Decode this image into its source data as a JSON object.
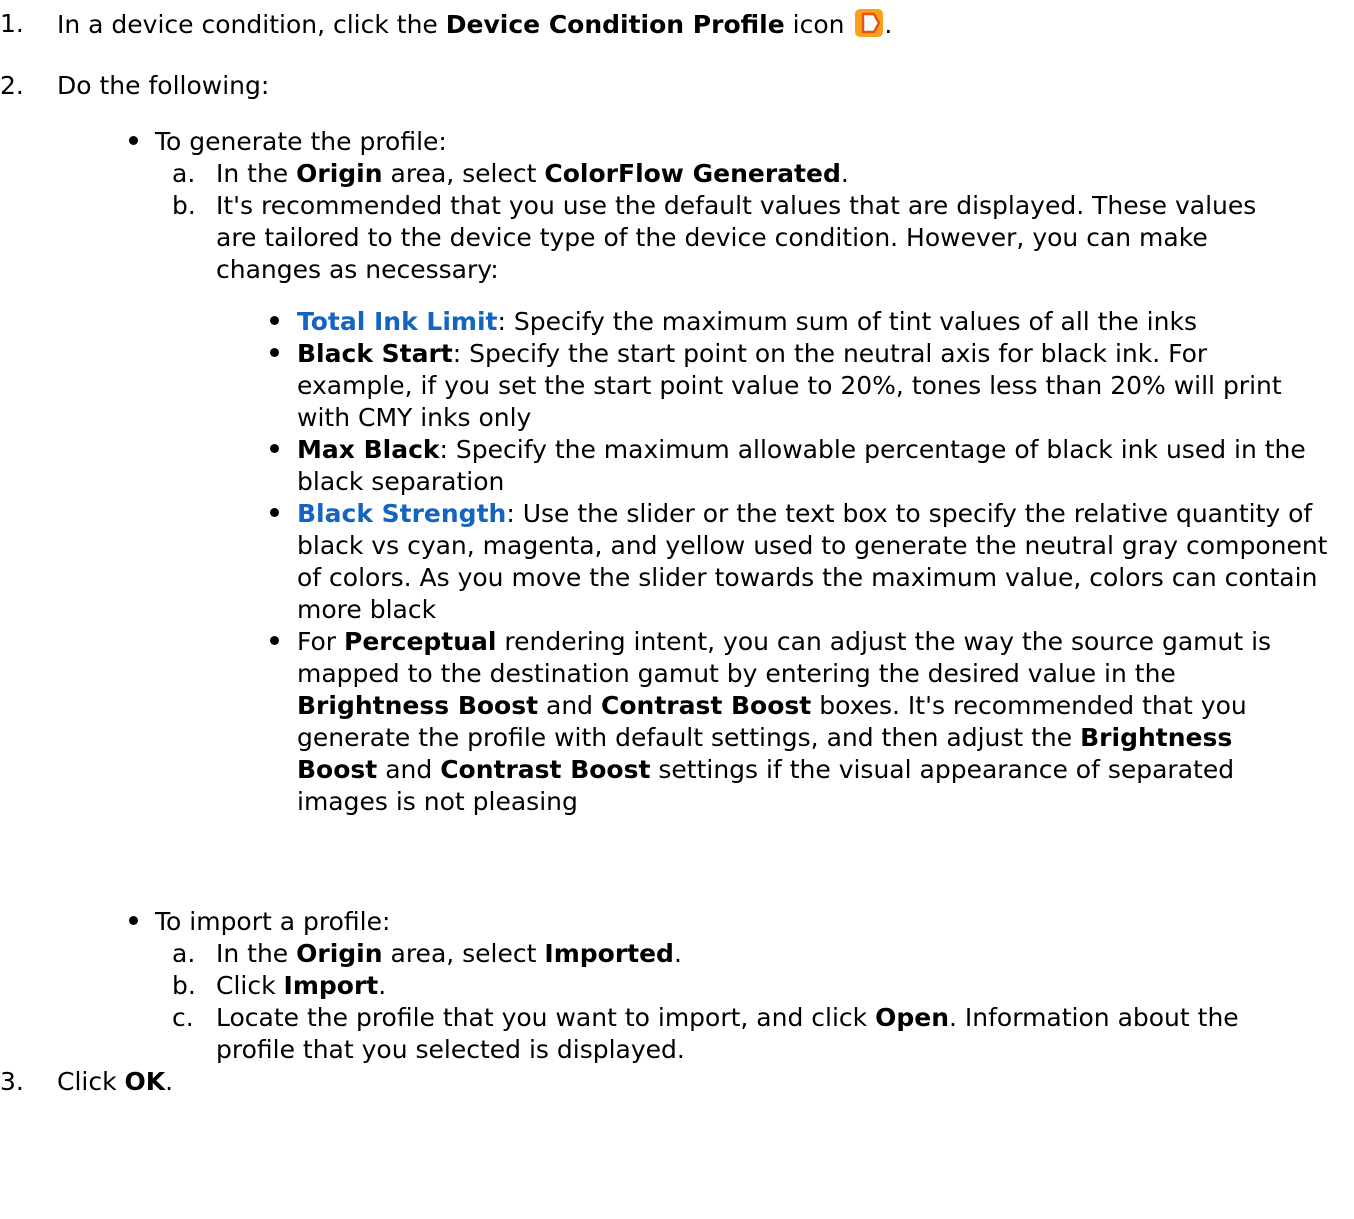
{
  "steps": [
    {
      "num": "1.",
      "parts": [
        {
          "t": "In a device condition, click the "
        },
        {
          "t": "Device Condition Profile",
          "b": true
        },
        {
          "t": " icon "
        },
        {
          "icon": "device-condition-profile-icon"
        },
        {
          "t": "."
        }
      ]
    },
    {
      "num": "2.",
      "parts": [
        {
          "t": "Do the following:"
        }
      ]
    },
    {
      "num": "3.",
      "parts": [
        {
          "t": "Click "
        },
        {
          "t": "OK",
          "b": true
        },
        {
          "t": "."
        }
      ]
    }
  ],
  "generate": {
    "intro": "To generate the profile:",
    "substeps": [
      {
        "letter": "a.",
        "parts": [
          {
            "t": "In the "
          },
          {
            "t": "Origin",
            "b": true
          },
          {
            "t": " area, select "
          },
          {
            "t": "ColorFlow Generated",
            "b": true
          },
          {
            "t": "."
          }
        ]
      },
      {
        "letter": "b.",
        "parts": [
          {
            "t": "It's recommended that you use the default values that are displayed. These values are tailored to the device type of the device condition. However, you can make changes as necessary:"
          }
        ]
      }
    ],
    "settings": [
      {
        "parts": [
          {
            "t": "Total Ink Limit",
            "link": true
          },
          {
            "t": ": Specify the maximum sum of tint values of all the inks"
          }
        ]
      },
      {
        "parts": [
          {
            "t": "Black Start",
            "b": true
          },
          {
            "t": ": Specify the start point on the neutral axis for black ink. For example, if you set the start point value to 20%, tones less than 20% will print with CMY inks only"
          }
        ]
      },
      {
        "parts": [
          {
            "t": "Max Black",
            "b": true
          },
          {
            "t": ": Specify the maximum allowable percentage of black ink used in the black separation"
          }
        ]
      },
      {
        "parts": [
          {
            "t": "Black Strength",
            "link": true
          },
          {
            "t": ": Use the slider or the text box to specify the relative quantity of black vs cyan, magenta, and yellow used to generate the neutral gray component of colors. As you move the slider towards the maximum value, colors can contain more black"
          }
        ]
      },
      {
        "parts": [
          {
            "t": "For "
          },
          {
            "t": "Perceptual",
            "b": true
          },
          {
            "t": " rendering intent, you can adjust the way the source gamut is mapped to the destination gamut by entering the desired value in the "
          },
          {
            "t": "Brightness Boost",
            "b": true
          },
          {
            "t": " and "
          },
          {
            "t": "Contrast Boost",
            "b": true
          },
          {
            "t": " boxes. It's recommended that you generate the profile with default settings, and then adjust the "
          },
          {
            "t": "Brightness Boost",
            "b": true
          },
          {
            "t": " and "
          },
          {
            "t": "Contrast Boost",
            "b": true
          },
          {
            "t": " settings if the visual appearance of separated images is not pleasing"
          }
        ]
      }
    ]
  },
  "import": {
    "intro": "To import a profile:",
    "substeps": [
      {
        "letter": "a.",
        "parts": [
          {
            "t": "In the "
          },
          {
            "t": "Origin",
            "b": true
          },
          {
            "t": " area, select "
          },
          {
            "t": "Imported",
            "b": true
          },
          {
            "t": "."
          }
        ]
      },
      {
        "letter": "b.",
        "parts": [
          {
            "t": "Click "
          },
          {
            "t": "Import",
            "b": true
          },
          {
            "t": "."
          }
        ]
      },
      {
        "letter": "c.",
        "parts": [
          {
            "t": "Locate the profile that you want to import, and click "
          },
          {
            "t": "Open",
            "b": true
          },
          {
            "t": ". Information about the profile that you selected is displayed."
          }
        ]
      }
    ]
  },
  "colors": {
    "link": "#1565c0",
    "icon_fill": "#f7a21b",
    "icon_stroke": "#e8541b"
  }
}
